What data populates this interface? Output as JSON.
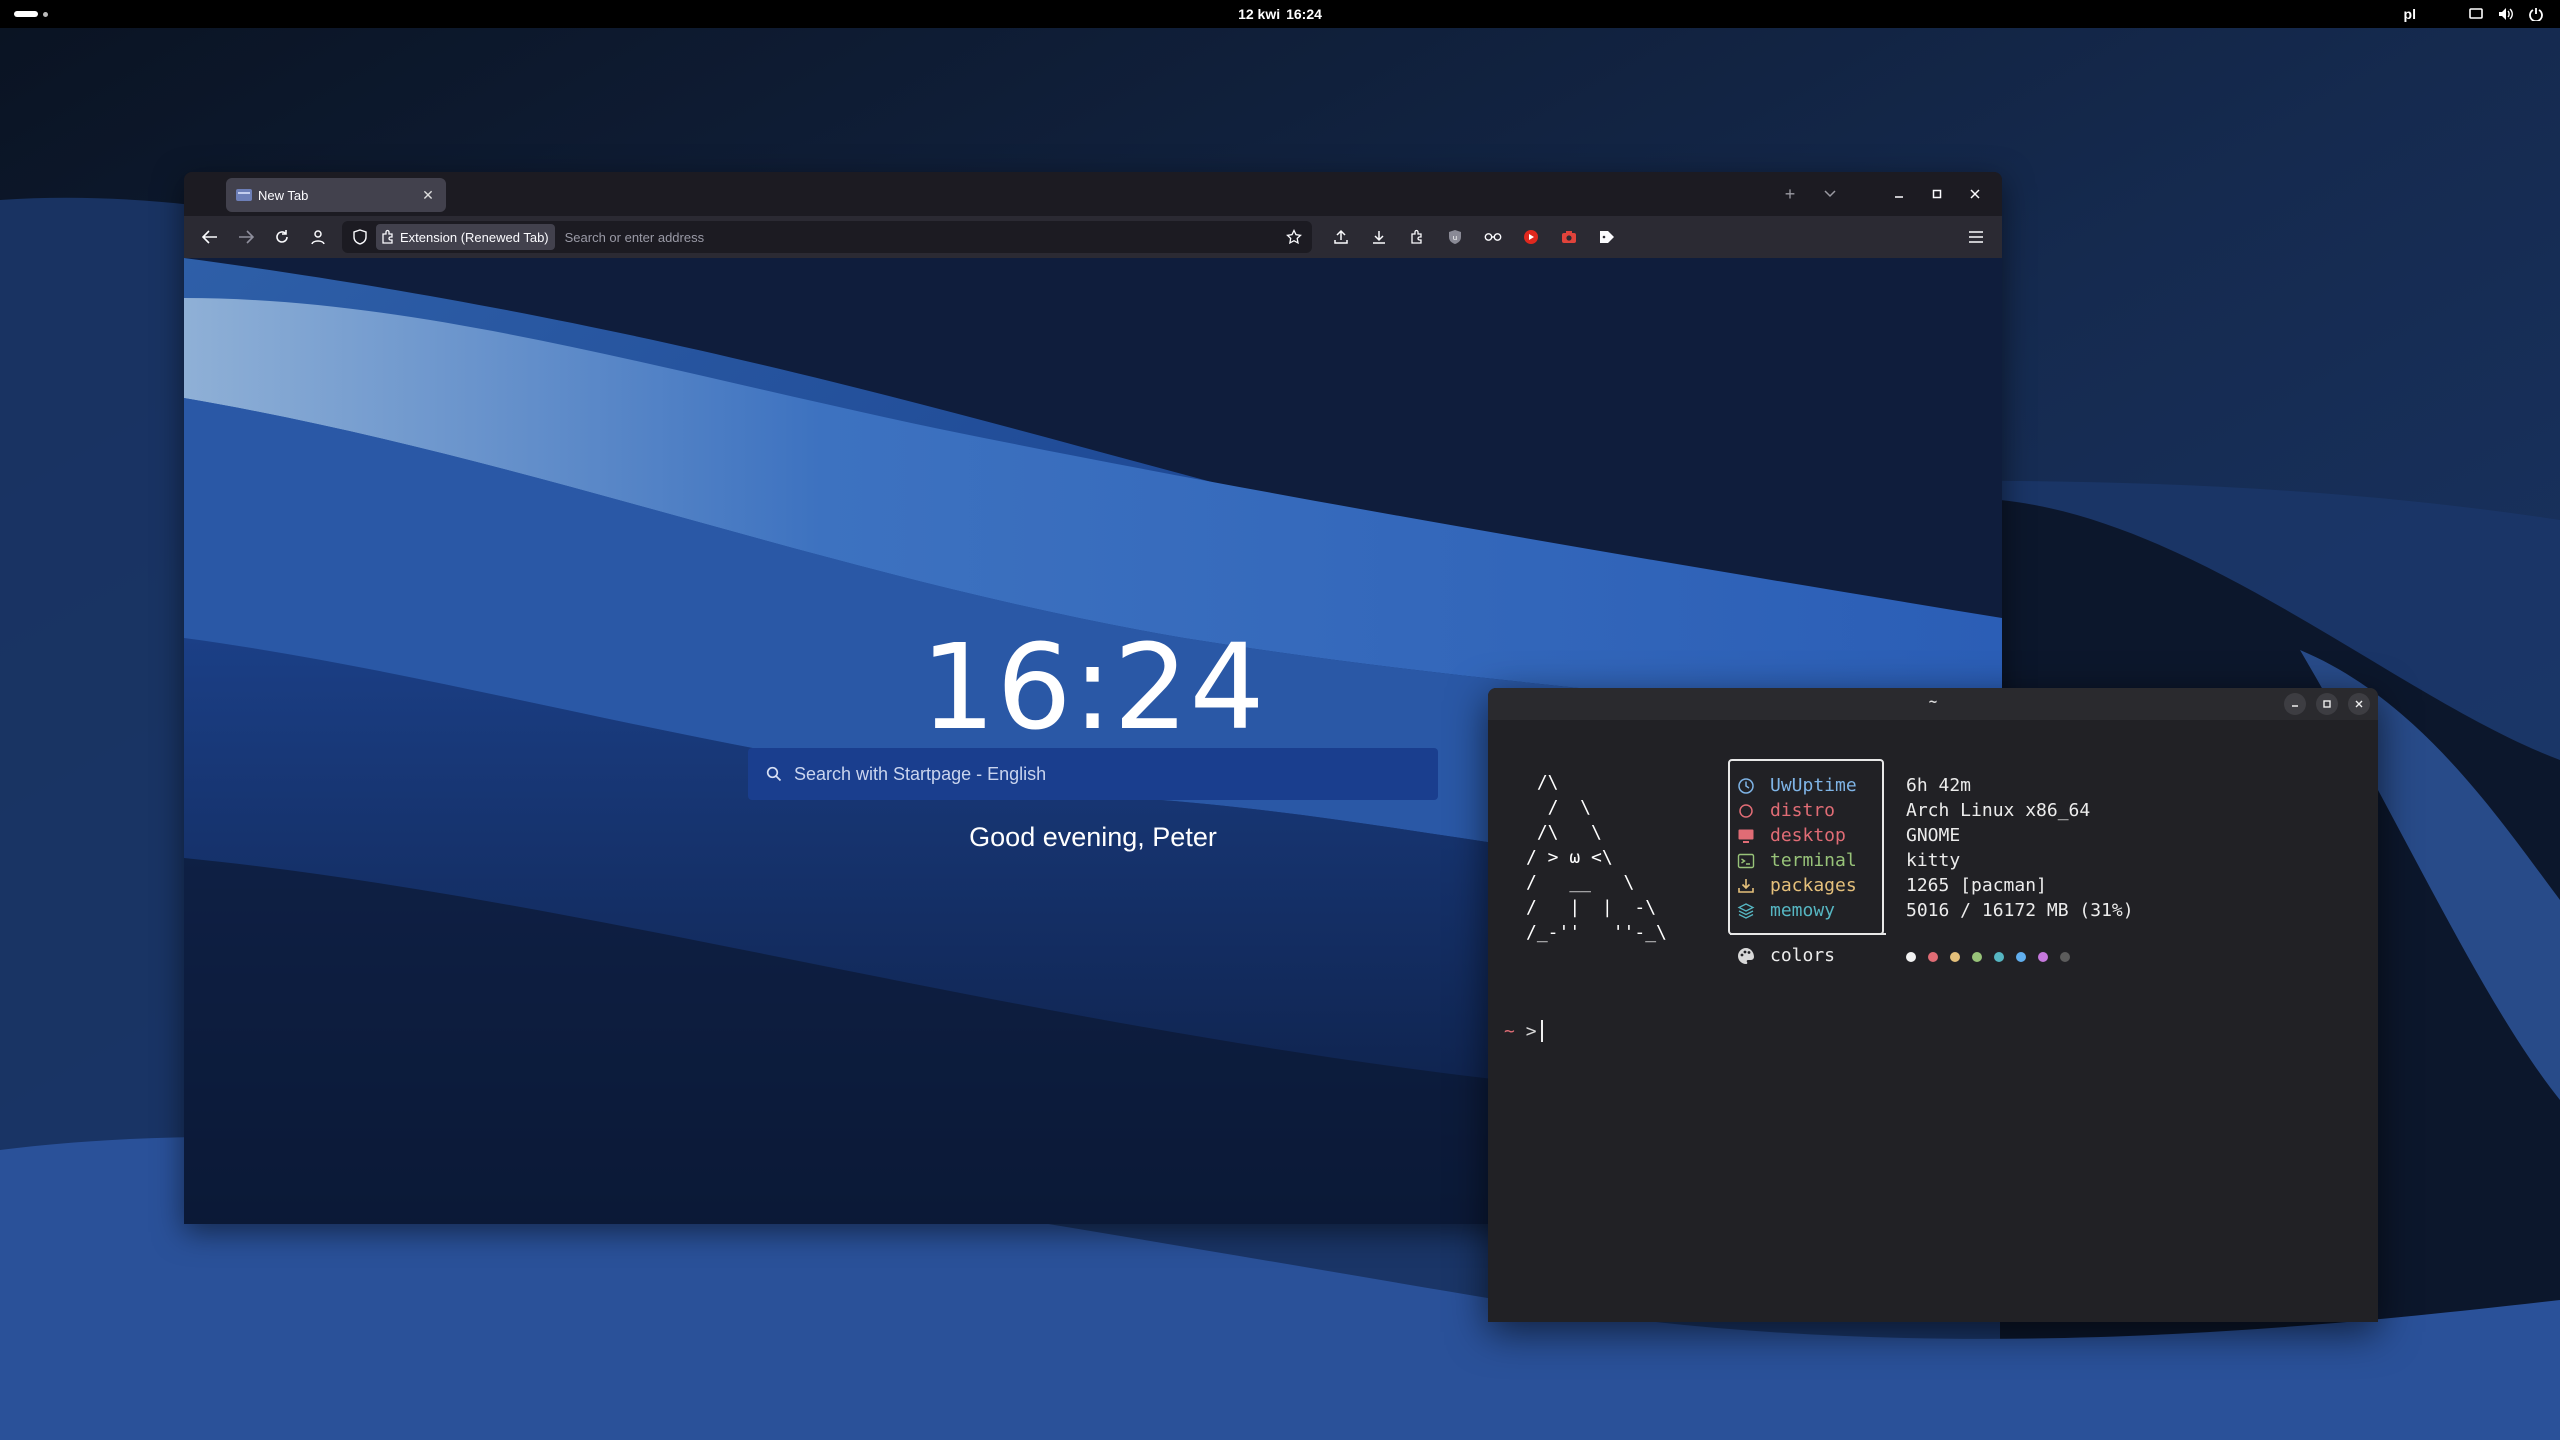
{
  "topbar": {
    "date": "12 kwi",
    "time": "16:24",
    "keyboard_layout": "pl",
    "tray_icons": [
      "screen-icon",
      "volume-icon",
      "power-icon"
    ]
  },
  "browser": {
    "tab": {
      "title": "New Tab",
      "favicon": "newtab-favicon-icon"
    },
    "toolbar_icons": [
      "back-icon",
      "forward-icon",
      "reload-icon",
      "account-icon",
      "star-icon",
      "upload-icon",
      "download-icon",
      "extensions-icon",
      "ublock-icon",
      "glasses-icon",
      "youtube-icon",
      "screenshot-icon",
      "tag-icon",
      "menu-icon"
    ],
    "urlbar": {
      "extension_label": "Extension (Renewed Tab)",
      "placeholder": "Search or enter address"
    },
    "newtab": {
      "clock": "16:24",
      "search_placeholder": "Search with Startpage - English",
      "greeting": "Good evening, Peter"
    }
  },
  "terminal": {
    "title": "~",
    "ascii_art": " /\\\n  /  \\\n /\\   \\\n/ > ω <\\\n/   __   \\\n/   |  |  -\\\n/_-''   ''-_\\",
    "info": [
      {
        "label": "UwUptime",
        "value": "6h 42m",
        "color": "#7fb4e6",
        "icon": "clock-icon"
      },
      {
        "label": "distro",
        "value": "Arch Linux x86_64",
        "color": "#e06c75",
        "icon": "circle-icon"
      },
      {
        "label": "desktop",
        "value": "GNOME",
        "color": "#e06c75",
        "icon": "monitor-icon"
      },
      {
        "label": "terminal",
        "value": "kitty",
        "color": "#98c379",
        "icon": "terminal-icon"
      },
      {
        "label": "packages",
        "value": "1265 [pacman]",
        "color": "#e5c07b",
        "icon": "package-icon"
      },
      {
        "label": "memowy",
        "value": "5016 / 16172 MB (31%)",
        "color": "#56b6c2",
        "icon": "layers-icon"
      }
    ],
    "colors_label": "colors",
    "swatch_colors": [
      "#f2f2f2",
      "#e06c75",
      "#e5c07b",
      "#98c379",
      "#56b6c2",
      "#61afef",
      "#c678dd",
      "#5c5c5c"
    ],
    "prompt": {
      "dir": "~",
      "symbol": ">"
    }
  }
}
